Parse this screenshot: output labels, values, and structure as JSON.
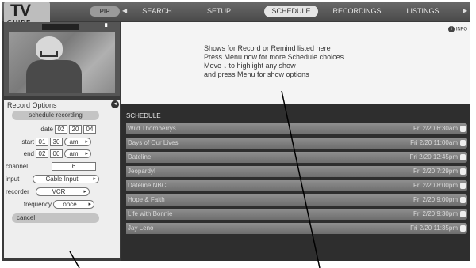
{
  "logo": {
    "line1": "TV",
    "line2": "GUIDE"
  },
  "nav": {
    "pip_label": "PIP",
    "tabs": [
      {
        "label": "SEARCH",
        "active": false
      },
      {
        "label": "SETUP",
        "active": false
      },
      {
        "label": "SCHEDULE",
        "active": true
      },
      {
        "label": "RECORDINGS",
        "active": false
      },
      {
        "label": "LISTINGS",
        "active": false
      }
    ]
  },
  "info": {
    "button_label": "INFO",
    "lines": [
      "Shows for Record or Remind listed here",
      "Press Menu now for more Schedule choices",
      "Move ↓ to highlight any show",
      "and press Menu for show options"
    ]
  },
  "record_options": {
    "title": "Record Options",
    "schedule_button": "schedule recording",
    "date": {
      "label": "date",
      "month": "02",
      "day": "20",
      "year": "04"
    },
    "start": {
      "label": "start",
      "hour": "01",
      "minute": "30",
      "ampm": "am"
    },
    "end": {
      "label": "end",
      "hour": "02",
      "minute": "00",
      "ampm": "am"
    },
    "channel": {
      "label": "channel",
      "value": "6"
    },
    "input": {
      "label": "input",
      "value": "Cable Input"
    },
    "recorder": {
      "label": "recorder",
      "value": "VCR"
    },
    "frequency": {
      "label": "frequency",
      "value": "once"
    },
    "cancel_button": "cancel"
  },
  "schedule": {
    "title": "SCHEDULE",
    "rows": [
      {
        "title": "Wild Thornberrys",
        "time": "Fri 2/20 6:30am"
      },
      {
        "title": "Days of Our Lives",
        "time": "Fri 2/20 11:00am"
      },
      {
        "title": "Dateline",
        "time": "Fri 2/20 12:45pm"
      },
      {
        "title": "Jeopardy!",
        "time": "Fri 2/20 7:29pm"
      },
      {
        "title": "Dateline NBC",
        "time": "Fri 2/20 8:00pm"
      },
      {
        "title": "Hope & Faith",
        "time": "Fri 2/20 9:00pm"
      },
      {
        "title": "Life with Bonnie",
        "time": "Fri 2/20 9:30pm"
      },
      {
        "title": "Jay Leno",
        "time": "Fri 2/20 11:35pm"
      }
    ]
  }
}
